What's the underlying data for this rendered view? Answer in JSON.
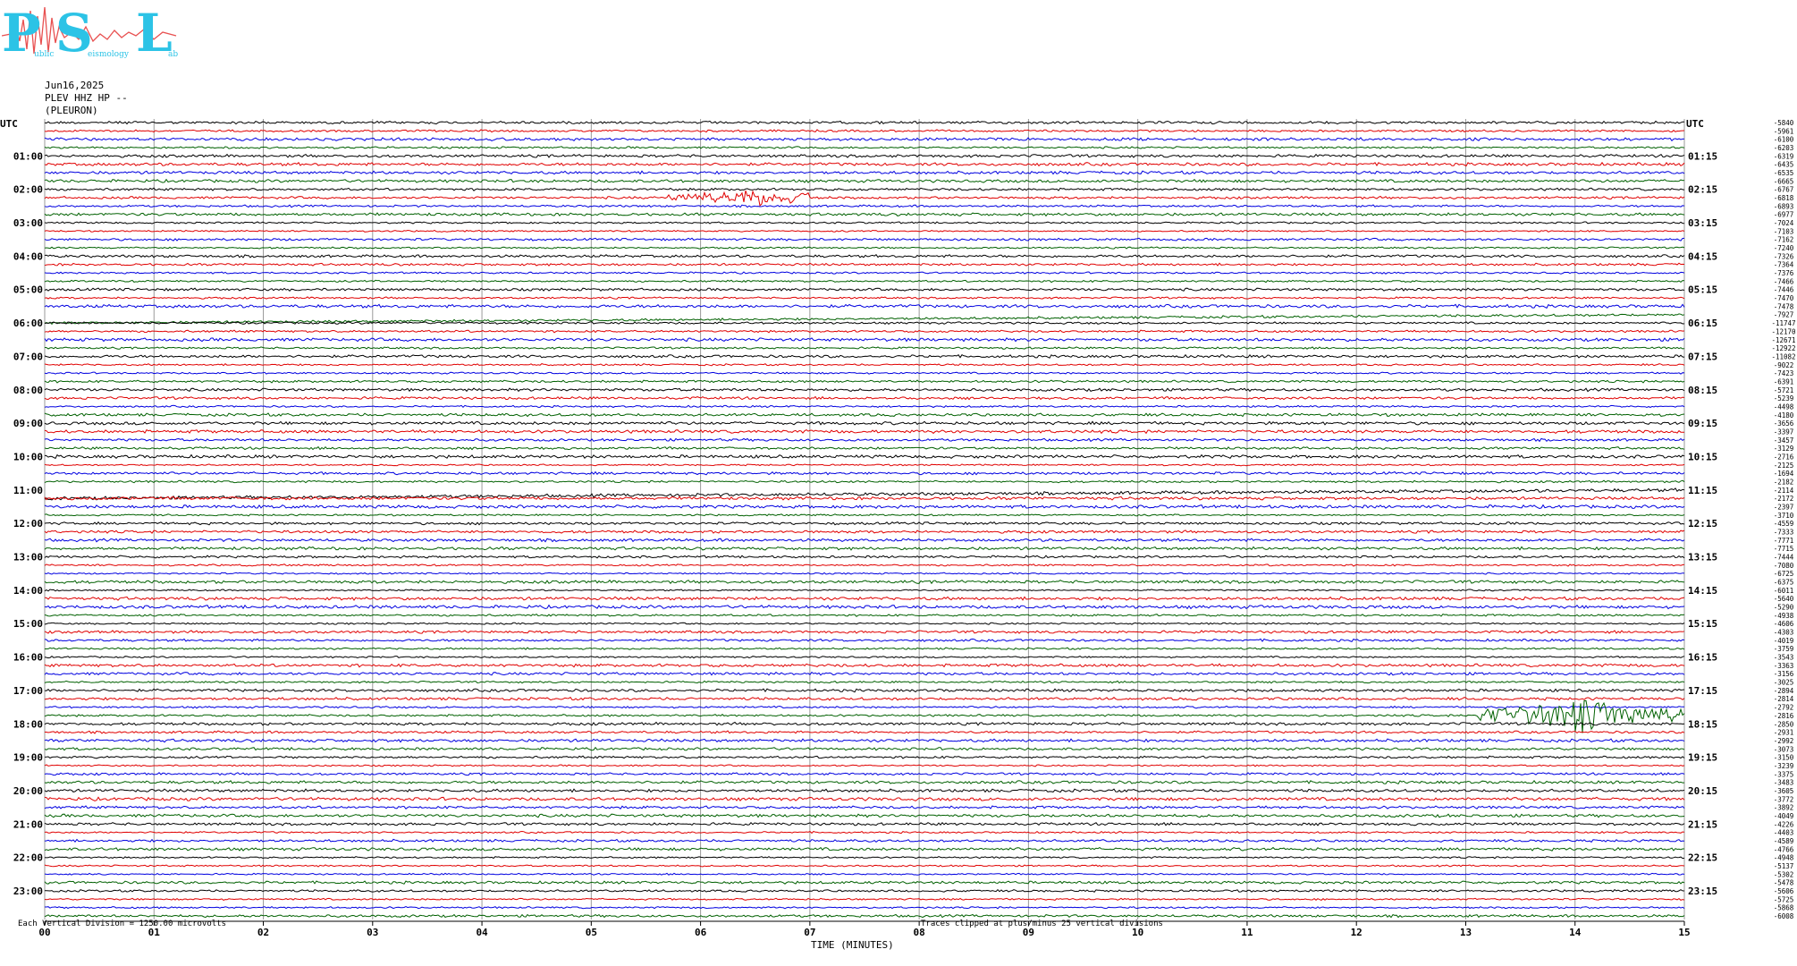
{
  "logo": {
    "letters": [
      "P",
      "S",
      "L"
    ],
    "words": [
      "ublic",
      "eismology",
      "ab"
    ]
  },
  "header": {
    "date": "Jun16,2025",
    "channel": "PLEV HHZ HP --",
    "station": "(PLEURON)"
  },
  "chart_data": {
    "type": "helicorder",
    "left_label": "UTC",
    "right_label": "UTC",
    "hour_labels_left": [
      "01:00",
      "02:00",
      "03:00",
      "04:00",
      "05:00",
      "06:00",
      "07:00",
      "08:00",
      "09:00",
      "10:00",
      "11:00",
      "12:00",
      "13:00",
      "14:00",
      "15:00",
      "16:00",
      "17:00",
      "18:00",
      "19:00",
      "20:00",
      "21:00",
      "22:00",
      "23:00"
    ],
    "hour_labels_right": [
      "01:15",
      "02:15",
      "03:15",
      "04:15",
      "05:15",
      "06:15",
      "07:15",
      "08:15",
      "09:15",
      "10:15",
      "11:15",
      "12:15",
      "13:15",
      "14:15",
      "15:15",
      "16:15",
      "17:15",
      "18:15",
      "19:15",
      "20:15",
      "21:15",
      "22:15",
      "23:15"
    ],
    "x_ticks": [
      "00",
      "01",
      "02",
      "03",
      "04",
      "05",
      "06",
      "07",
      "08",
      "09",
      "10",
      "11",
      "12",
      "13",
      "14",
      "15"
    ],
    "xlabel": "TIME (MINUTES)",
    "scale_note": "Each Vertical Division = 1250.00 microvolts",
    "clip_note": "Traces clipped at plus/minus 25 vertical divisions",
    "trace_colors": [
      "#000000",
      "#e00000",
      "#0000e0",
      "#006000"
    ],
    "right_values": [
      "-5840",
      "-5961",
      "-6100",
      "-6203",
      "-6319",
      "-6435",
      "-6535",
      "-6665",
      "-6767",
      "-6818",
      "-6893",
      "-6977",
      "-7024",
      "-7103",
      "-7162",
      "-7240",
      "-7326",
      "-7364",
      "-7376",
      "-7466",
      "-7446",
      "-7470",
      "-7478",
      "-7927",
      "-11747",
      "-12170",
      "-12671",
      "-12922",
      "-11082",
      "-9022",
      "-7423",
      "-6391",
      "-5721",
      "-5239",
      "-4498",
      "-4180",
      "-3656",
      "-3397",
      "-3457",
      "-3129",
      "-2716",
      "-2125",
      "-1694",
      "-2182",
      "-2114",
      "-2172",
      "-2397",
      "-3710",
      "-4559",
      "-7333",
      "-7771",
      "-7715",
      "-7444",
      "-7080",
      "-6725",
      "-6375",
      "-6011",
      "-5640",
      "-5290",
      "-4938",
      "-4606",
      "-4303",
      "-4019",
      "-3759",
      "-3543",
      "-3363",
      "-3156",
      "-3025",
      "-2894",
      "-2814",
      "-2792",
      "-2816",
      "-2850",
      "-2931",
      "-2992",
      "-3073",
      "-3150",
      "-3239",
      "-3375",
      "-3483",
      "-3605",
      "-3772",
      "-3892",
      "-4049",
      "-4226",
      "-4403",
      "-4589",
      "-4766",
      "-4948",
      "-5137",
      "-5302",
      "-5478",
      "-5606",
      "-5725",
      "-5868",
      "-6008"
    ],
    "events": [
      {
        "trace_index": 9,
        "start_min": 5.7,
        "end_min": 7.0,
        "peak_min": 6.5,
        "amplitude_div": 0.9
      },
      {
        "trace_index": 71,
        "start_min": 13.1,
        "end_min": 15.0,
        "peak_min": 14.05,
        "amplitude_div": 2.2
      }
    ],
    "drifts": [
      {
        "trace_index": 23,
        "shape": "ramp"
      },
      {
        "trace_index": 44,
        "shape": "ramp"
      }
    ]
  }
}
